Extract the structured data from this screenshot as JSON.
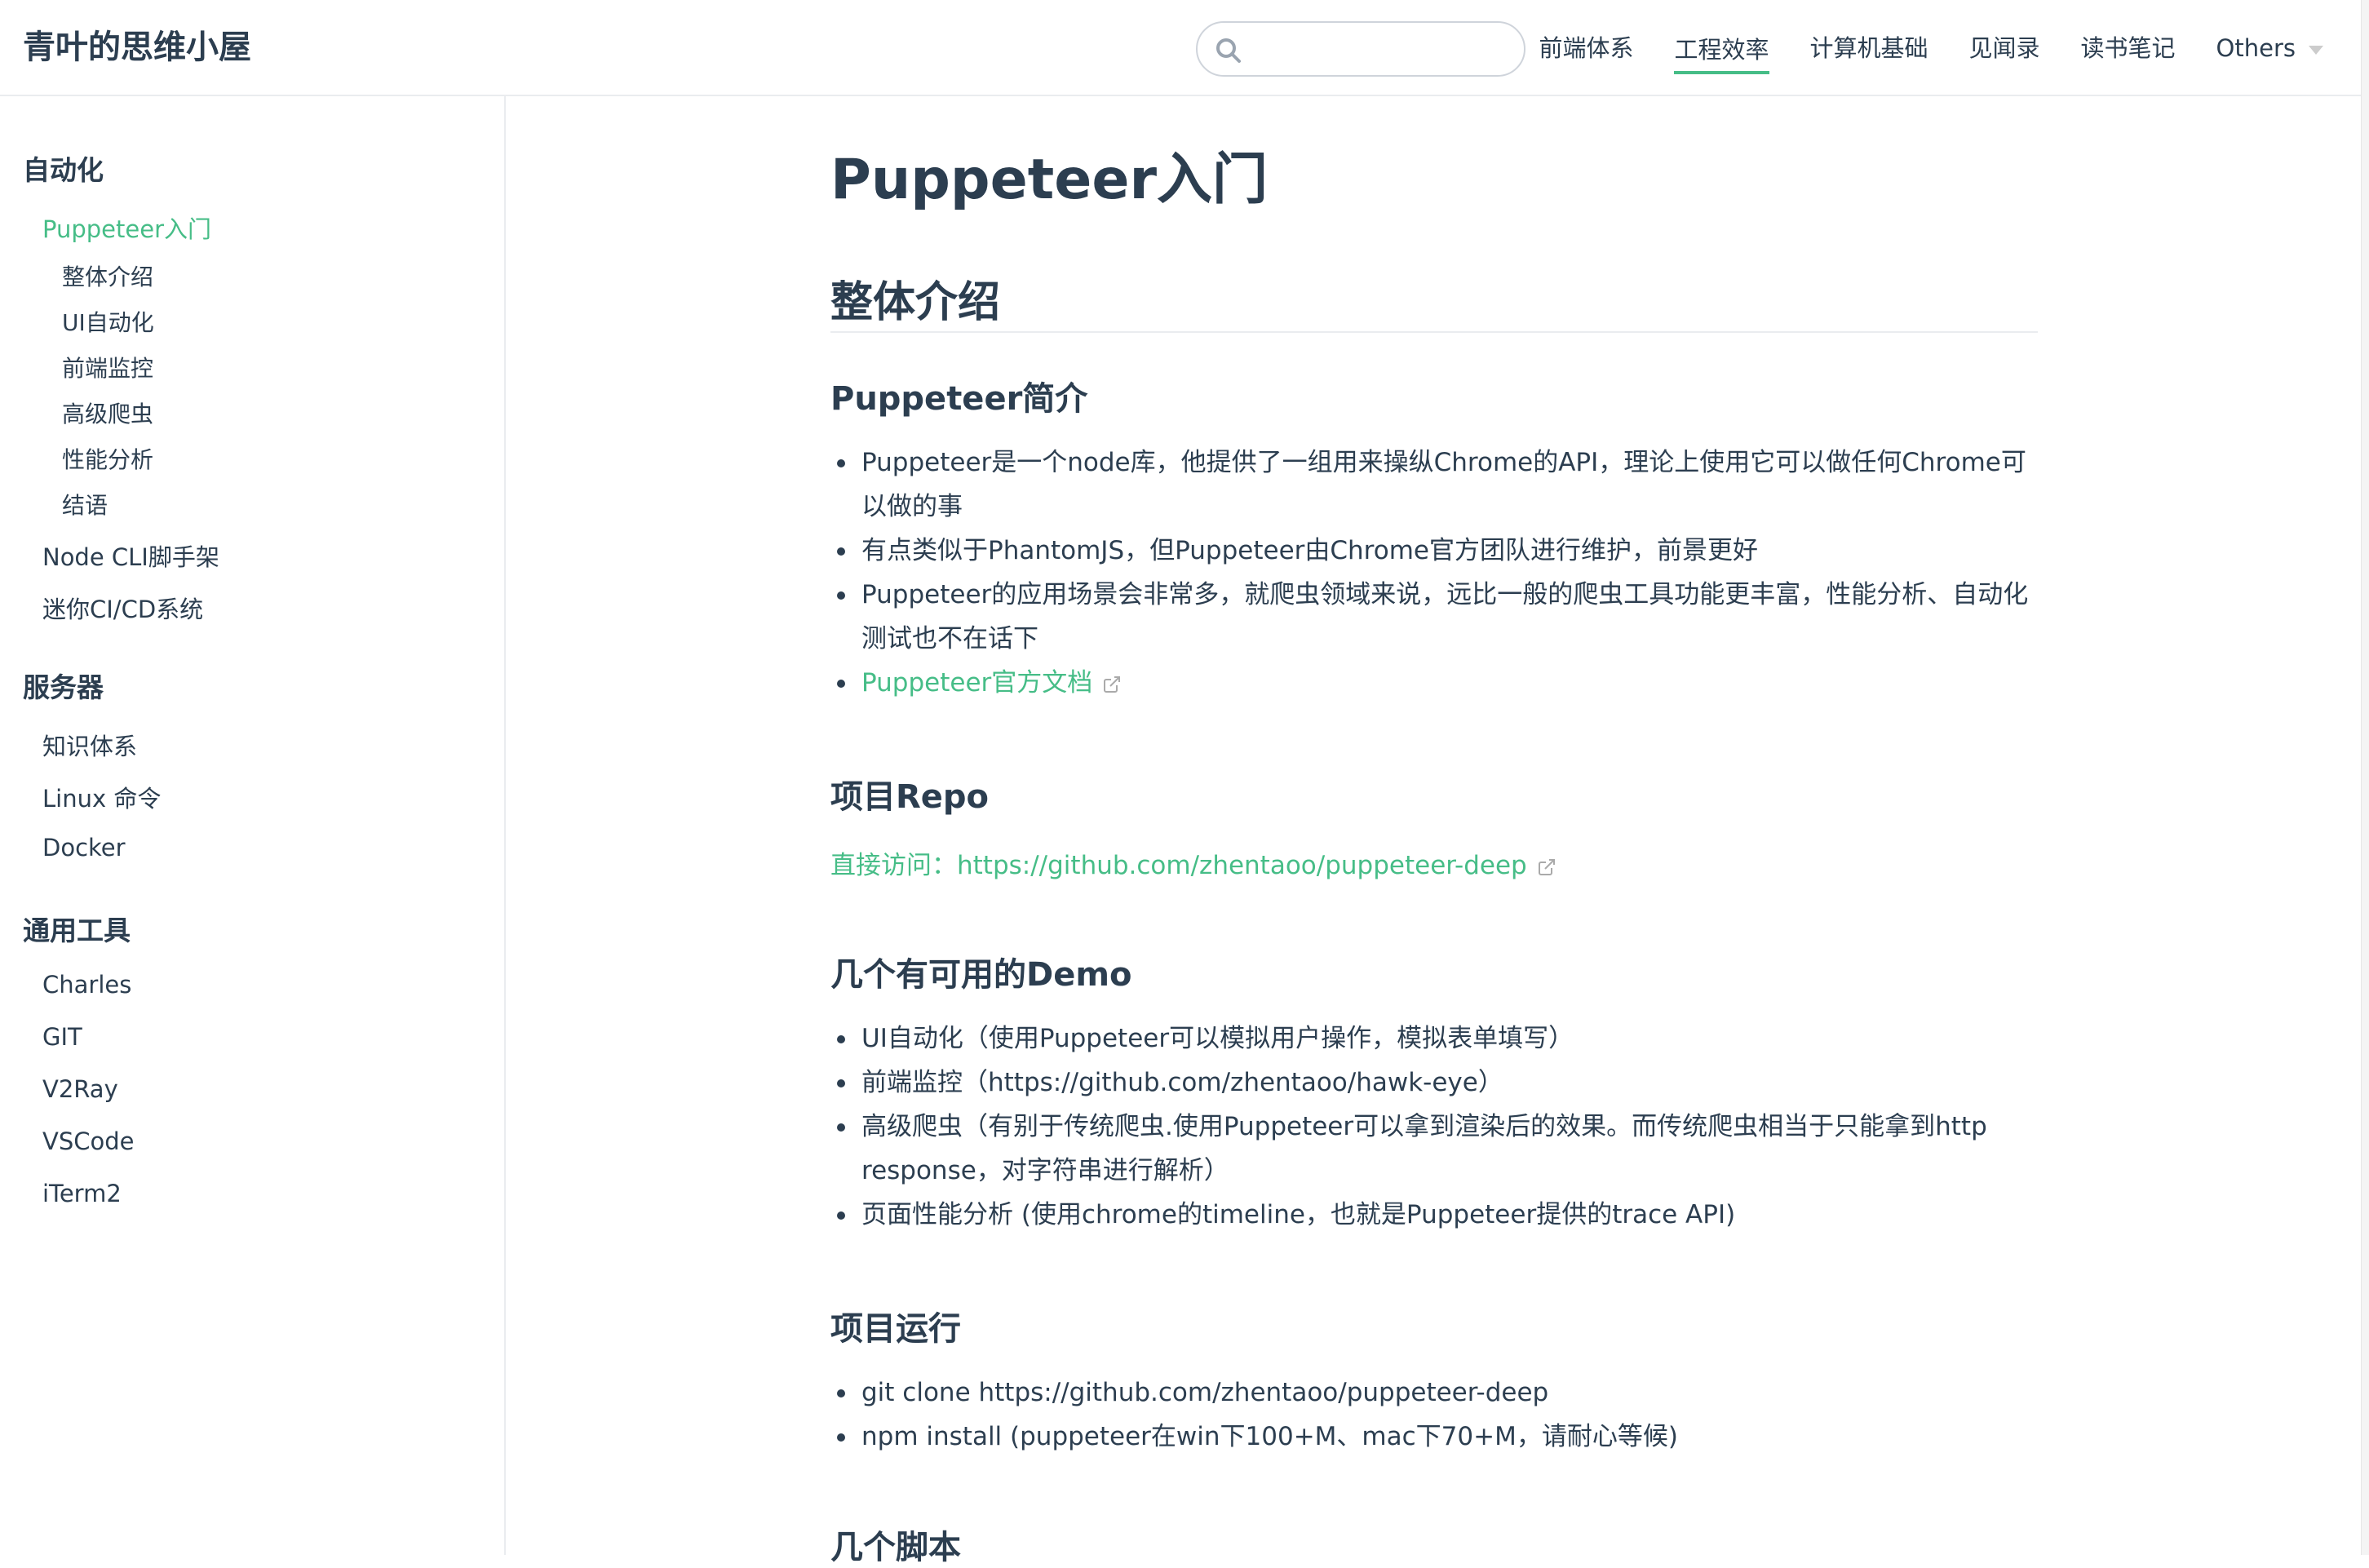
{
  "navbar": {
    "site_name": "青叶的思维小屋",
    "search": {
      "placeholder": "",
      "value": ""
    },
    "links": [
      {
        "label": "前端体系"
      },
      {
        "label": "工程效率"
      },
      {
        "label": "计算机基础"
      },
      {
        "label": "见闻录"
      },
      {
        "label": "读书笔记"
      },
      {
        "label": "Others"
      }
    ],
    "active_link": "工程效率",
    "accent_color": "#46bd87"
  },
  "sidebar": {
    "groups": [
      {
        "title": "自动化",
        "items": [
          {
            "label": "Puppeteer入门",
            "active": true,
            "children": [
              "整体介绍",
              "UI自动化",
              "前端监控",
              "高级爬虫",
              "性能分析",
              "结语"
            ]
          },
          {
            "label": "Node CLI脚手架"
          },
          {
            "label": "迷你CI/CD系统"
          }
        ]
      },
      {
        "title": "服务器",
        "items": [
          {
            "label": "知识体系"
          },
          {
            "label": "Linux 命令"
          },
          {
            "label": "Docker"
          }
        ]
      },
      {
        "title": "通用工具",
        "items": [
          {
            "label": "Charles"
          },
          {
            "label": "GIT"
          },
          {
            "label": "V2Ray"
          },
          {
            "label": "VSCode"
          },
          {
            "label": "iTerm2"
          }
        ]
      }
    ]
  },
  "content": {
    "title": "Puppeteer入门",
    "section_overview": {
      "heading": "整体介绍",
      "intro": {
        "heading": "Puppeteer简介",
        "bullets": [
          "Puppeteer是一个node库，他提供了一组用来操纵Chrome的API，理论上使用它可以做任何Chrome可以做的事",
          "有点类似于PhantomJS，但Puppeteer由Chrome官方团队进行维护，前景更好",
          "Puppeteer的应用场景会非常多，就爬虫领域来说，远比一般的爬虫工具功能更丰富，性能分析、自动化测试也不在话下"
        ],
        "doc_link": "Puppeteer官方文档"
      },
      "repo": {
        "heading": "项目Repo",
        "link_text": "直接访问：https://github.com/zhentaoo/puppeteer-deep"
      },
      "demos": {
        "heading": "几个有可用的Demo",
        "bullets": [
          "UI自动化（使用Puppeteer可以模拟用户操作，模拟表单填写）",
          "前端监控（https://github.com/zhentaoo/hawk-eye）",
          "高级爬虫（有别于传统爬虫.使用Puppeteer可以拿到渲染后的效果。而传统爬虫相当于只能拿到http response，对字符串进行解析）",
          "页面性能分析 (使用chrome的timeline，也就是Puppeteer提供的trace API)"
        ]
      },
      "run": {
        "heading": "项目运行",
        "bullets": [
          "git clone https://github.com/zhentaoo/puppeteer-deep",
          "npm install (puppeteer在win下100+M、mac下70+M，请耐心等候)"
        ]
      },
      "scripts": {
        "heading": "几个脚本"
      }
    }
  }
}
